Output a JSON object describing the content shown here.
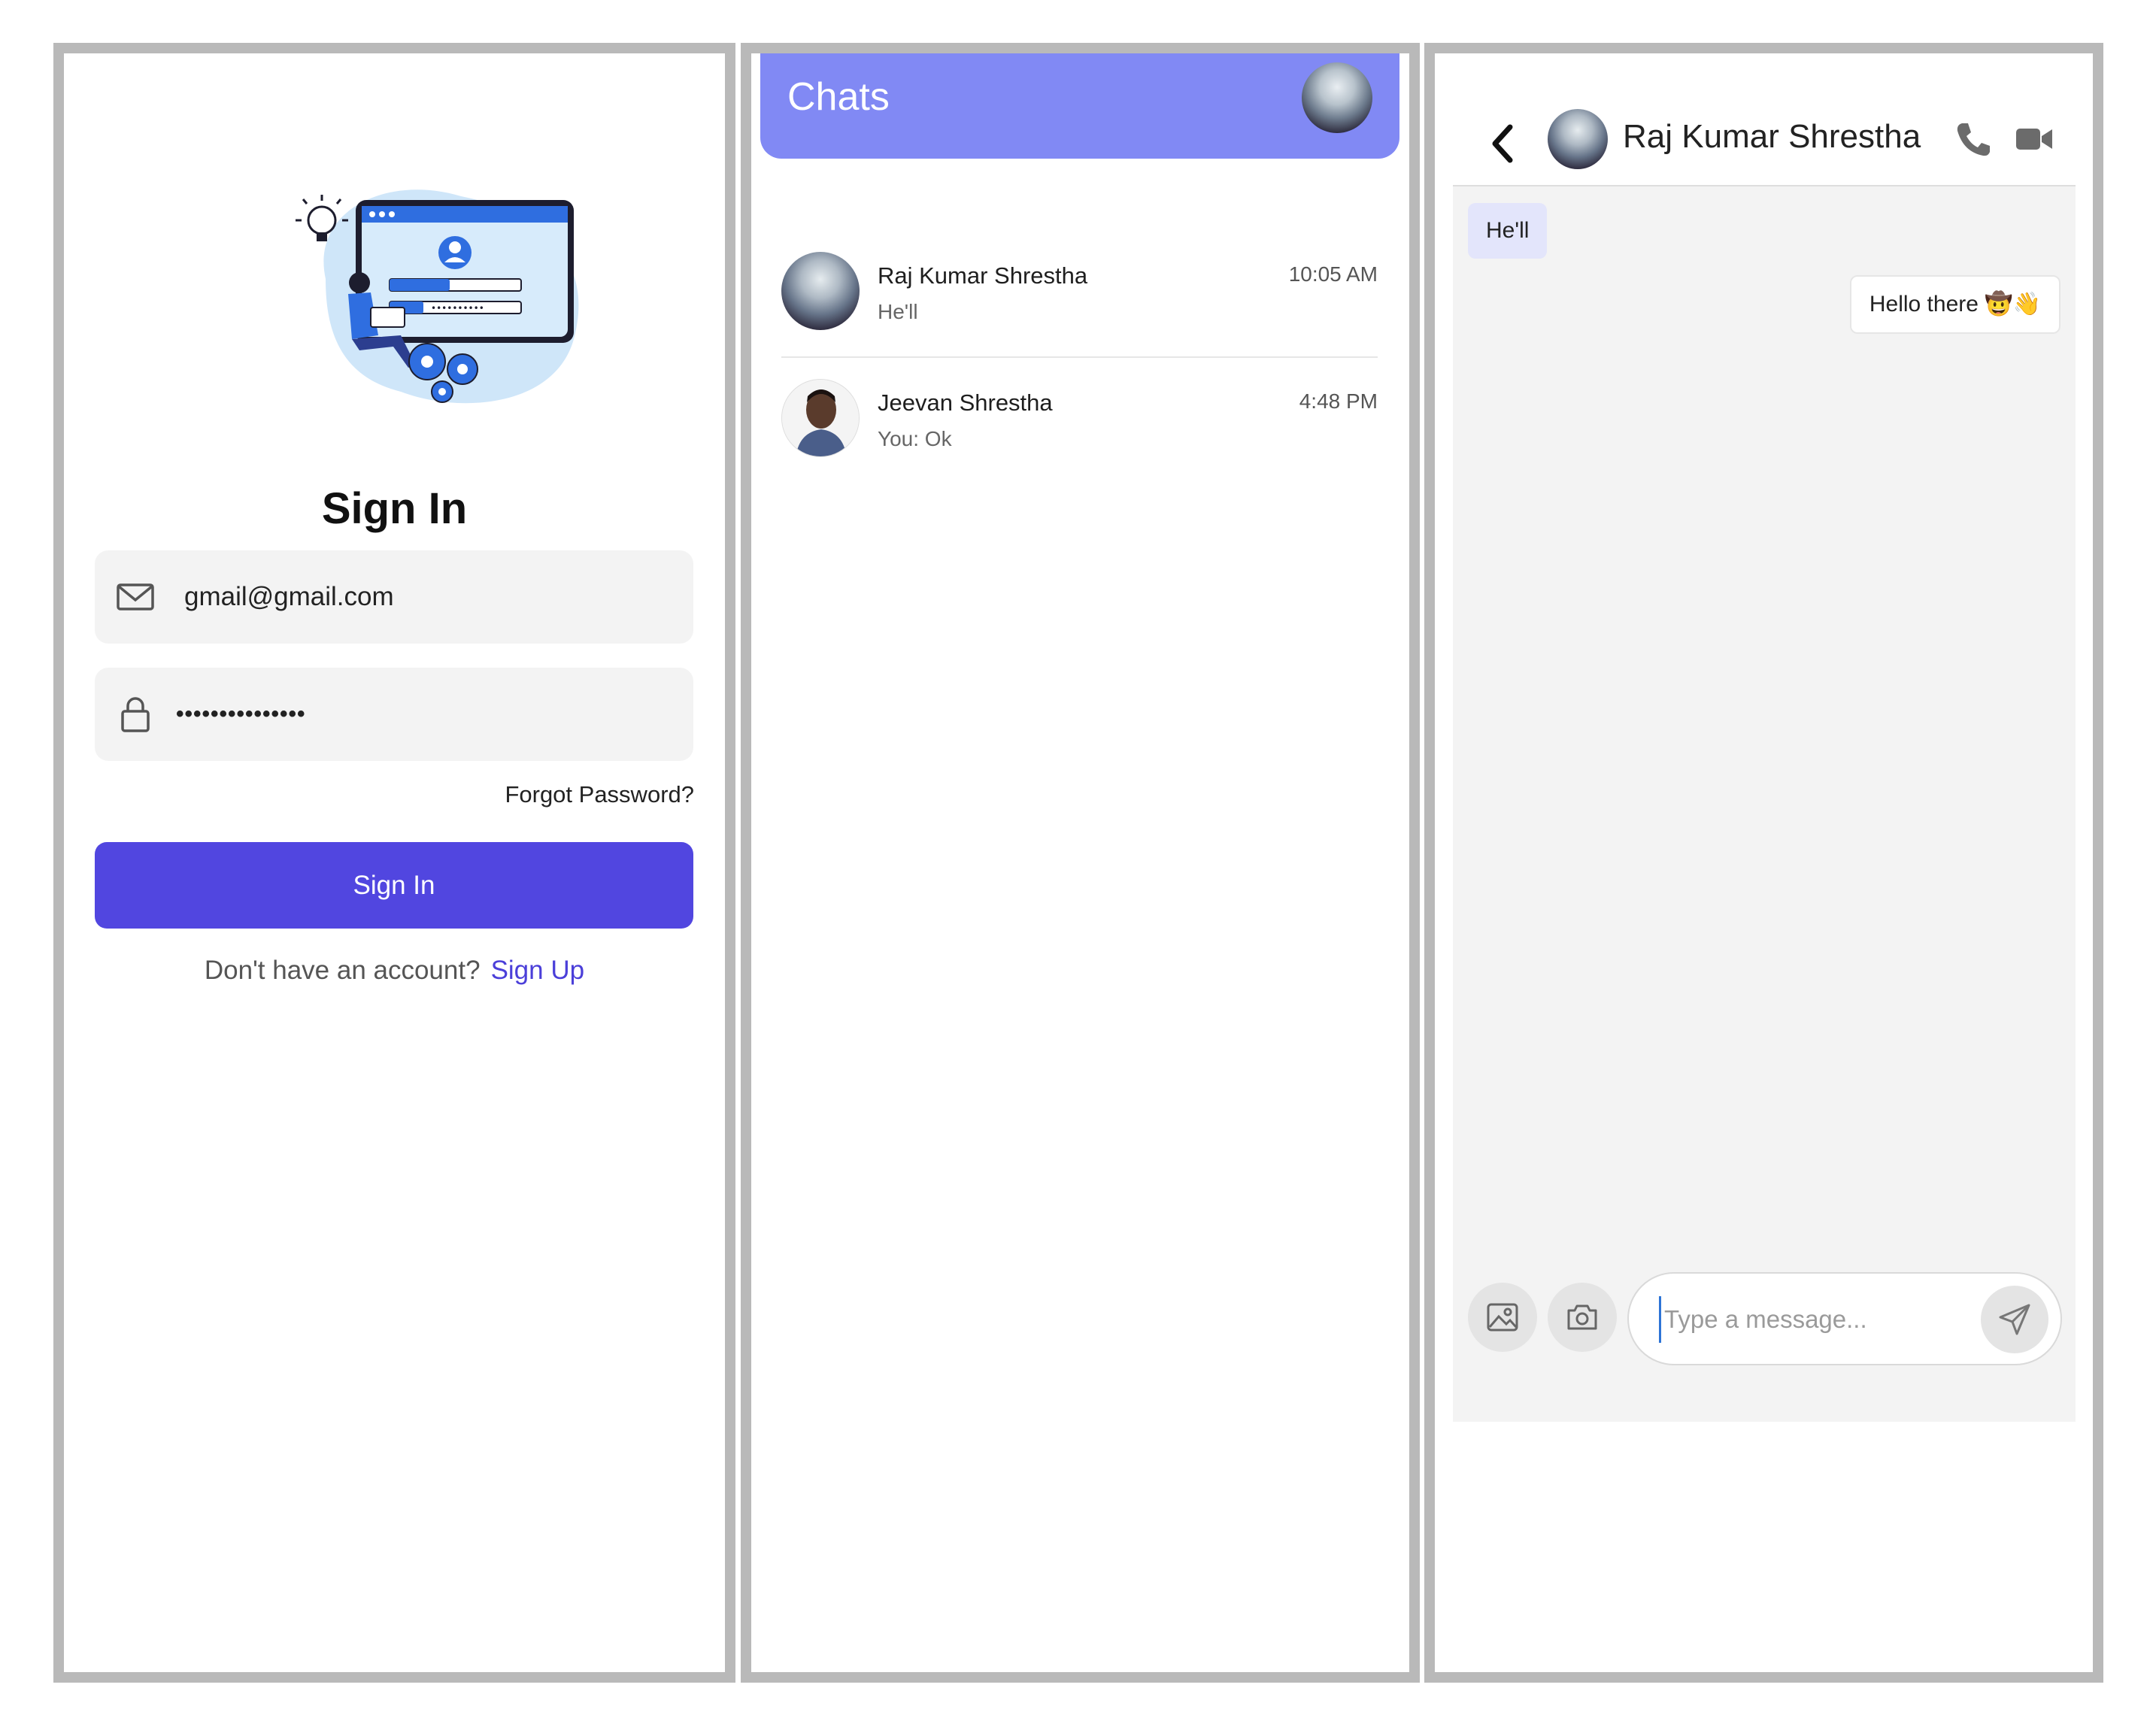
{
  "signin": {
    "title": "Sign In",
    "email_value": "gmail@gmail.com",
    "password_masked": "•••••••••••••••",
    "forgot_label": "Forgot Password?",
    "button_label": "Sign In",
    "no_account_text": "Don't have an account?",
    "signup_link": "Sign Up"
  },
  "chats": {
    "title": "Chats",
    "items": [
      {
        "name": "Raj Kumar Shrestha",
        "preview": "He'll",
        "time": "10:05 AM"
      },
      {
        "name": "Jeevan Shrestha",
        "preview": "You: Ok",
        "time": "4:48 PM"
      }
    ]
  },
  "conversation": {
    "contact_name": "Raj Kumar Shrestha",
    "messages": [
      {
        "direction": "incoming",
        "text": "He'll"
      },
      {
        "direction": "outgoing",
        "text": "Hello there",
        "emoji": "🤠👋"
      }
    ],
    "input_placeholder": "Type a message..."
  },
  "colors": {
    "primary": "#5146e0",
    "chats_header": "#8189f4",
    "link": "#4b3fd9",
    "incoming_bubble": "#e3e5fb",
    "frame_border": "#b9b9b9"
  },
  "icons": [
    "mail-icon",
    "lock-icon",
    "back-arrow-icon",
    "phone-icon",
    "video-camera-icon",
    "image-icon",
    "camera-icon",
    "send-icon"
  ]
}
